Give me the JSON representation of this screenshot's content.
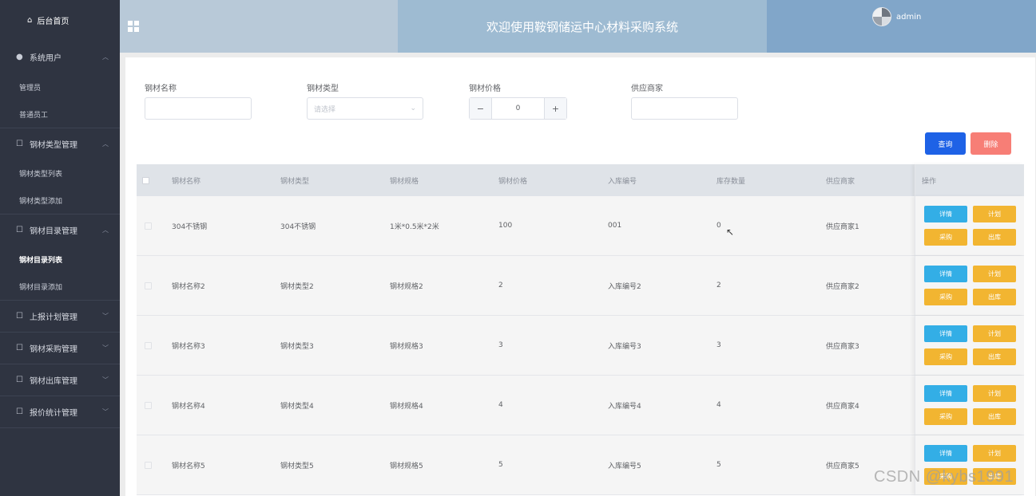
{
  "sidebar": {
    "home": "后台首页",
    "groups": [
      {
        "title": "系统用户",
        "icon": "user-icon",
        "expanded": true,
        "items": [
          {
            "label": "管理员"
          },
          {
            "label": "普通员工"
          }
        ]
      },
      {
        "title": "钢材类型管理",
        "icon": "folder-icon",
        "expanded": true,
        "items": [
          {
            "label": "钢材类型列表"
          },
          {
            "label": "钢材类型添加"
          }
        ]
      },
      {
        "title": "钢材目录管理",
        "icon": "folder-icon",
        "expanded": true,
        "items": [
          {
            "label": "钢材目录列表",
            "active": true
          },
          {
            "label": "钢材目录添加"
          }
        ]
      },
      {
        "title": "上报计划管理",
        "icon": "folder-icon",
        "expanded": false,
        "items": []
      },
      {
        "title": "钢材采购管理",
        "icon": "folder-icon",
        "expanded": false,
        "items": []
      },
      {
        "title": "钢材出库管理",
        "icon": "folder-icon",
        "expanded": false,
        "items": []
      },
      {
        "title": "报价统计管理",
        "icon": "folder-icon",
        "expanded": false,
        "items": []
      }
    ]
  },
  "header": {
    "title": "欢迎使用鞍钢储运中心材料采购系统",
    "username": "admin"
  },
  "filters": {
    "name_label": "钢材名称",
    "name_value": "",
    "type_label": "钢材类型",
    "type_placeholder": "请选择",
    "price_label": "钢材价格",
    "price_value": "0",
    "supplier_label": "供应商家",
    "supplier_value": ""
  },
  "actions": {
    "query": "查询",
    "delete": "删除"
  },
  "table": {
    "columns": [
      "钢材名称",
      "钢材类型",
      "钢材规格",
      "钢材价格",
      "入库编号",
      "库存数量",
      "供应商家",
      "操作"
    ],
    "rows": [
      [
        "304不锈钢",
        "304不锈钢",
        "1米*0.5米*2米",
        "100",
        "001",
        "0",
        "供应商家1"
      ],
      [
        "钢材名称2",
        "钢材类型2",
        "钢材规格2",
        "2",
        "入库编号2",
        "2",
        "供应商家2"
      ],
      [
        "钢材名称3",
        "钢材类型3",
        "钢材规格3",
        "3",
        "入库编号3",
        "3",
        "供应商家3"
      ],
      [
        "钢材名称4",
        "钢材类型4",
        "钢材规格4",
        "4",
        "入库编号4",
        "4",
        "供应商家4"
      ],
      [
        "钢材名称5",
        "钢材类型5",
        "钢材规格5",
        "5",
        "入库编号5",
        "5",
        "供应商家5"
      ]
    ],
    "row_actions": {
      "detail": "详情",
      "plan": "计划",
      "purchase": "采购",
      "outbound": "出库"
    }
  },
  "watermark": "CSDN @kybs1991",
  "colors": {
    "sidebar": "#2f3441",
    "primary": "#1e62e6",
    "danger": "#f77e76",
    "info": "#33aee6",
    "warning": "#f2b531"
  }
}
